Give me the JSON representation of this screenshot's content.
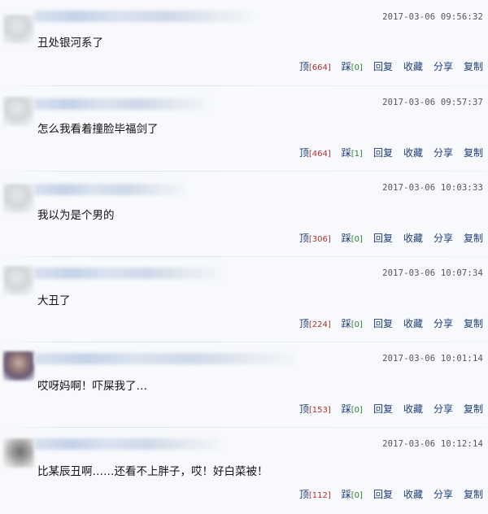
{
  "comments": [
    {
      "timestamp": "2017-03-06 09:56:32",
      "content": "丑处银河系了",
      "up_label": "顶",
      "up_count": "[664]",
      "down_label": "踩",
      "down_count": "[0]",
      "reply_label": "回复",
      "fav_label": "收藏",
      "share_label": "分享",
      "copy_label": "复制"
    },
    {
      "timestamp": "2017-03-06 09:57:37",
      "content": "怎么我看着撞脸毕福剑了",
      "up_label": "顶",
      "up_count": "[464]",
      "down_label": "踩",
      "down_count": "[1]",
      "reply_label": "回复",
      "fav_label": "收藏",
      "share_label": "分享",
      "copy_label": "复制"
    },
    {
      "timestamp": "2017-03-06 10:03:33",
      "content": "我以为是个男的",
      "up_label": "顶",
      "up_count": "[306]",
      "down_label": "踩",
      "down_count": "[0]",
      "reply_label": "回复",
      "fav_label": "收藏",
      "share_label": "分享",
      "copy_label": "复制"
    },
    {
      "timestamp": "2017-03-06 10:07:34",
      "content": "大丑了",
      "up_label": "顶",
      "up_count": "[224]",
      "down_label": "踩",
      "down_count": "[0]",
      "reply_label": "回复",
      "fav_label": "收藏",
      "share_label": "分享",
      "copy_label": "复制"
    },
    {
      "timestamp": "2017-03-06 10:01:14",
      "content": "哎呀妈啊！吓屎我了…",
      "up_label": "顶",
      "up_count": "[153]",
      "down_label": "踩",
      "down_count": "[0]",
      "reply_label": "回复",
      "fav_label": "收藏",
      "share_label": "分享",
      "copy_label": "复制"
    },
    {
      "timestamp": "2017-03-06 10:12:14",
      "content": "比某辰丑啊……还看不上胖子，哎！好白菜被！",
      "up_label": "顶",
      "up_count": "[112]",
      "down_label": "踩",
      "down_count": "[0]",
      "reply_label": "回复",
      "fav_label": "收藏",
      "share_label": "分享",
      "copy_label": "复制"
    }
  ]
}
